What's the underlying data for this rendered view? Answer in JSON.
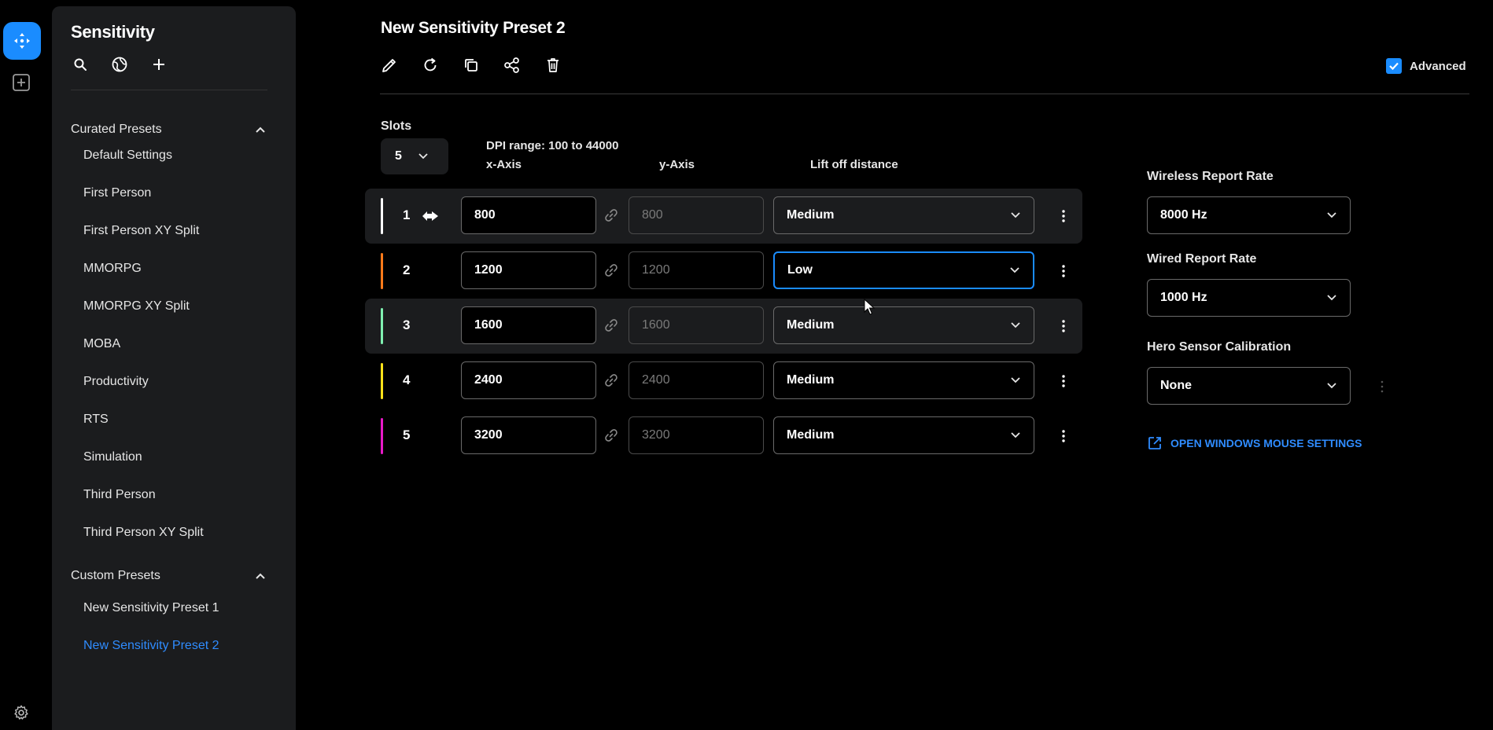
{
  "sidebar": {
    "title": "Sensitivity",
    "curated_header": "Curated Presets",
    "curated_presets": [
      "Default Settings",
      "First Person",
      "First Person XY Split",
      "MMORPG",
      "MMORPG XY Split",
      "MOBA",
      "Productivity",
      "RTS",
      "Simulation",
      "Third Person",
      "Third Person XY Split"
    ],
    "custom_header": "Custom Presets",
    "custom_presets": [
      "New Sensitivity Preset 1",
      "New Sensitivity Preset 2"
    ],
    "active_preset": "New Sensitivity Preset 2"
  },
  "header": {
    "title": "New Sensitivity Preset 2",
    "advanced_label": "Advanced",
    "advanced_checked": true
  },
  "slots": {
    "label": "Slots",
    "value": "5",
    "dpi_range": "DPI range: 100 to 44000",
    "col_x": "x-Axis",
    "col_y": "y-Axis",
    "col_lift": "Lift off distance",
    "rows": [
      {
        "num": "1",
        "x": "800",
        "y": "800",
        "lift": "Medium",
        "color": "#ffffff"
      },
      {
        "num": "2",
        "x": "1200",
        "y": "1200",
        "lift": "Low",
        "color": "#ff7a1a"
      },
      {
        "num": "3",
        "x": "1600",
        "y": "1600",
        "lift": "Medium",
        "color": "#7ff0b0"
      },
      {
        "num": "4",
        "x": "2400",
        "y": "2400",
        "lift": "Medium",
        "color": "#ffe21a"
      },
      {
        "num": "5",
        "x": "3200",
        "y": "3200",
        "lift": "Medium",
        "color": "#e81ac8"
      }
    ]
  },
  "right_panel": {
    "wireless_label": "Wireless Report Rate",
    "wireless_value": "8000 Hz",
    "wired_label": "Wired Report Rate",
    "wired_value": "1000 Hz",
    "hero_label": "Hero Sensor Calibration",
    "hero_value": "None",
    "open_link": "OPEN WINDOWS MOUSE SETTINGS"
  },
  "colors": {
    "accent": "#1a8cff",
    "link": "#2f8cff"
  }
}
